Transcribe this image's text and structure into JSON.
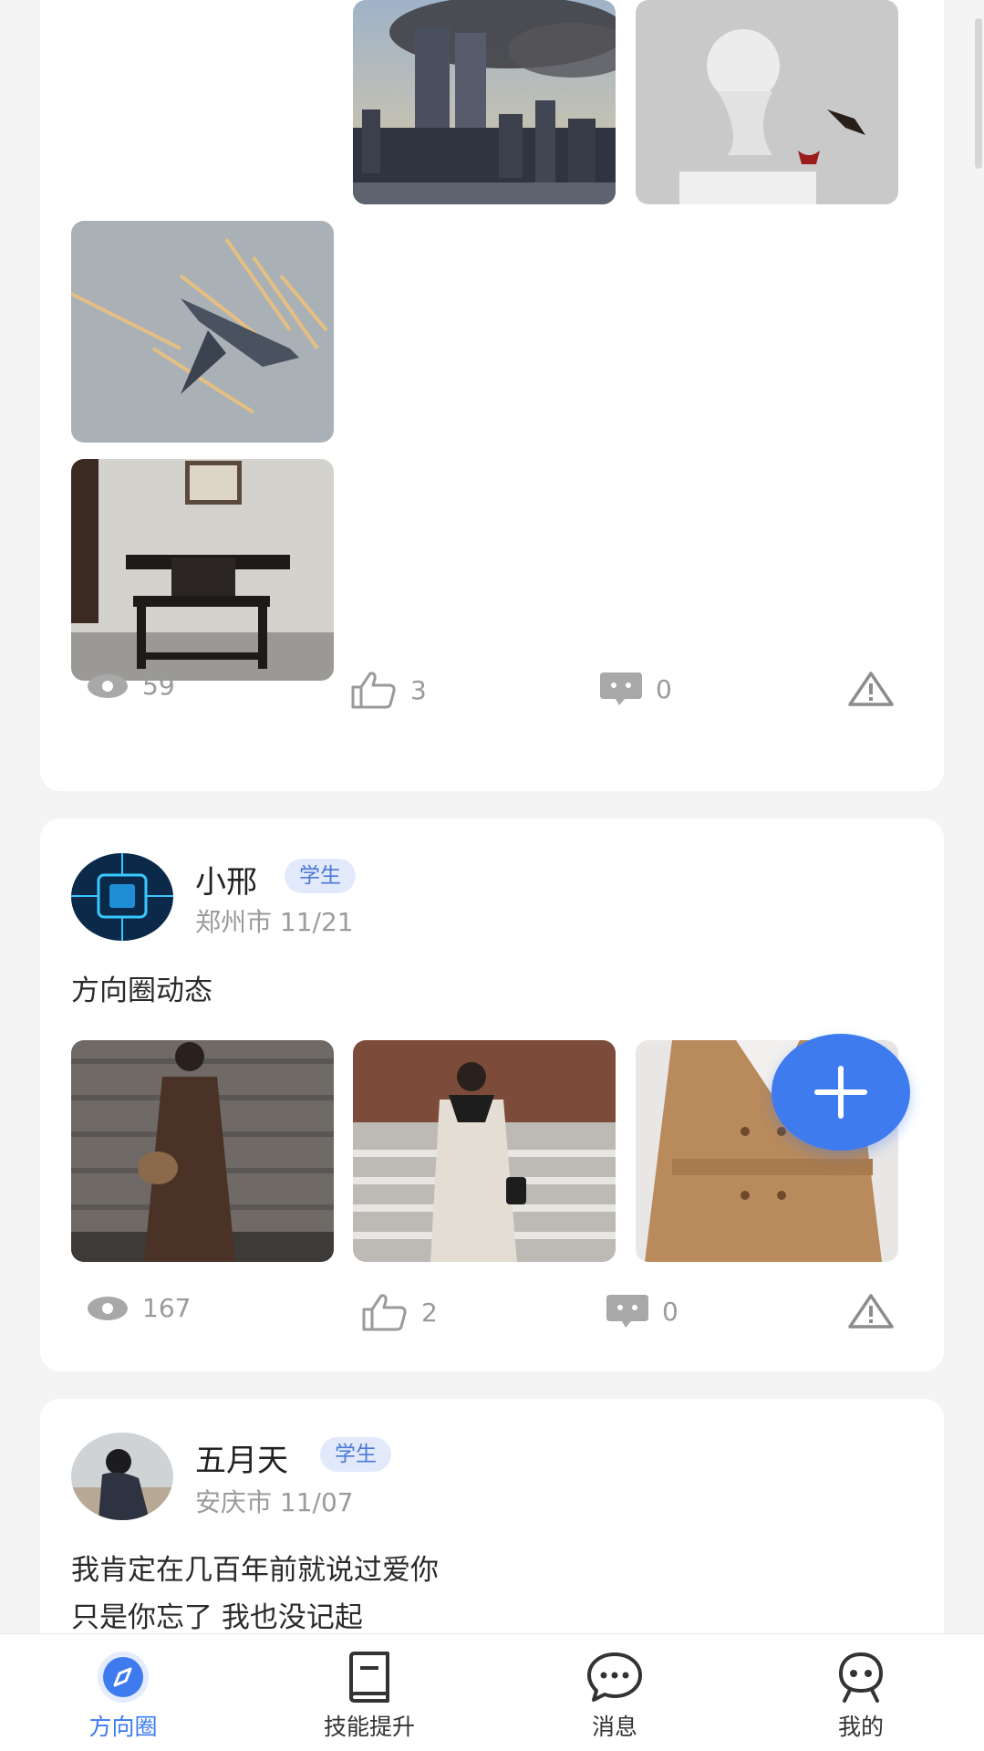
{
  "posts": [
    {
      "stats": {
        "views": "59",
        "likes": "3",
        "comments": "0"
      }
    },
    {
      "user": {
        "name": "小邢",
        "badge": "学生",
        "meta": "郑州市 11/21"
      },
      "text": "方向圈动态",
      "stats": {
        "views": "167",
        "likes": "2",
        "comments": "0"
      }
    },
    {
      "user": {
        "name": "五月天",
        "badge": "学生",
        "meta": "安庆市 11/07"
      },
      "lines": [
        "我肯定在几百年前就说过爱你",
        "只是你忘了 我也没记起"
      ]
    }
  ],
  "tabbar": {
    "items": [
      {
        "label": "方向圈",
        "icon": "compass-icon",
        "active": true
      },
      {
        "label": "技能提升",
        "icon": "book-icon"
      },
      {
        "label": "消息",
        "icon": "chat-bubble-icon"
      },
      {
        "label": "我的",
        "icon": "robot-face-icon"
      }
    ]
  },
  "colors": {
    "accent": "#3d7bef",
    "badge_bg": "#e1e9fb",
    "badge_text": "#4b78d8",
    "muted": "#9a9a9a",
    "page_bg": "#f4f4f5"
  }
}
